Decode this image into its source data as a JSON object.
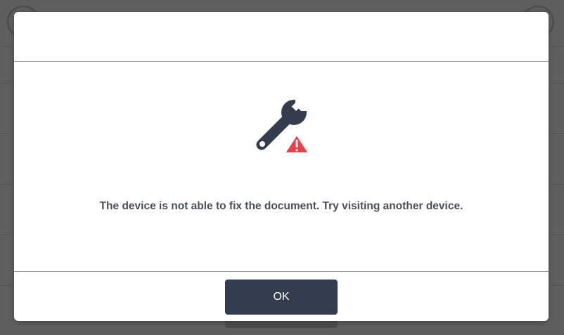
{
  "dialog": {
    "icon": "wrench-warning-icon",
    "message": "The device is not able to fix the document. Try visiting another device.",
    "ok_label": "OK"
  },
  "colors": {
    "button_bg": "#343d4e",
    "icon_dark": "#343d4e",
    "warning_red": "#e8404a",
    "text": "#4a4f5c"
  }
}
